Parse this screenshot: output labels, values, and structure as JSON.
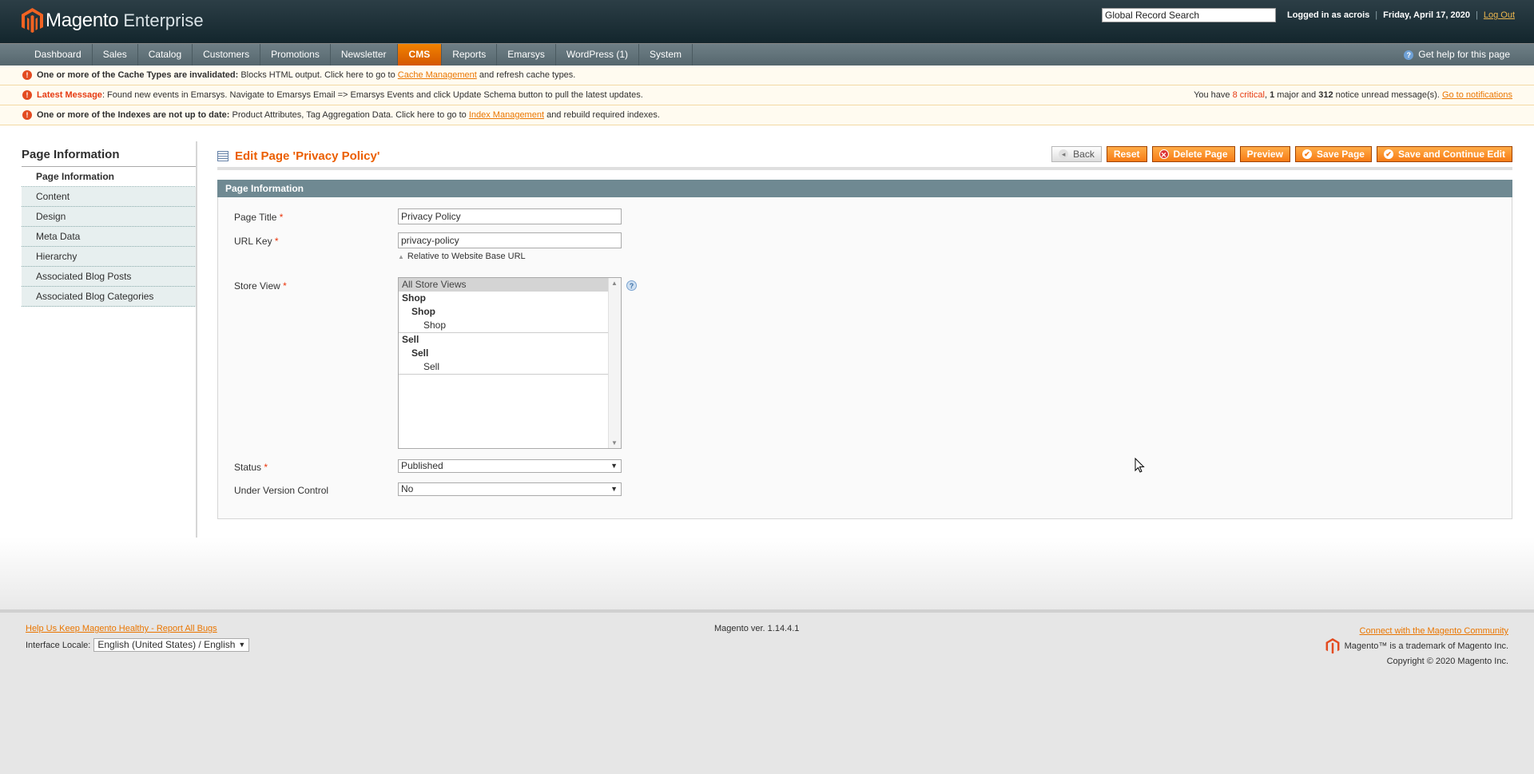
{
  "header": {
    "brand": "Magento",
    "brand_sub": "Enterprise",
    "search_value": "Global Record Search",
    "logged_in_text": "Logged in as acrois",
    "date": "Friday, April 17, 2020",
    "logout": "Log Out",
    "separator": "|"
  },
  "nav": {
    "items": [
      "Dashboard",
      "Sales",
      "Catalog",
      "Customers",
      "Promotions",
      "Newsletter",
      "CMS",
      "Reports",
      "Emarsys",
      "WordPress (1)",
      "System"
    ],
    "active": "CMS",
    "help": "Get help for this page"
  },
  "messages": {
    "cache_bold": "One or more of the Cache Types are invalidated:",
    "cache_text1": " Blocks HTML output. Click here to go to ",
    "cache_link": "Cache Management",
    "cache_text2": " and refresh cache types.",
    "latest_label": "Latest Message",
    "latest_text": ": Found new events in Emarsys. Navigate to Emarsys Email => Emarsys Events and click Update Schema button to pull the latest updates.",
    "unread_pre": "You have ",
    "critical": "8 critical",
    "comma": ", ",
    "major_count": "1",
    "major_text": " major and ",
    "notice_count": "312",
    "notice_text": " notice unread message(s). ",
    "notifications_link": "Go to notifications",
    "index_bold": "One or more of the Indexes are not up to date:",
    "index_text1": " Product Attributes, Tag Aggregation Data. Click here to go to ",
    "index_link": "Index Management",
    "index_text2": " and rebuild required indexes."
  },
  "sidebar": {
    "title": "Page Information",
    "items": [
      "Page Information",
      "Content",
      "Design",
      "Meta Data",
      "Hierarchy",
      "Associated Blog Posts",
      "Associated Blog Categories"
    ]
  },
  "page": {
    "title": "Edit Page 'Privacy Policy'",
    "buttons": {
      "back": "Back",
      "reset": "Reset",
      "delete": "Delete Page",
      "preview": "Preview",
      "save": "Save Page",
      "save_continue": "Save and Continue Edit"
    }
  },
  "form": {
    "section_title": "Page Information",
    "required_mark": "*",
    "page_title_label": "Page Title",
    "page_title_value": "Privacy Policy",
    "url_key_label": "URL Key",
    "url_key_value": "privacy-policy",
    "url_note": "Relative to Website Base URL",
    "store_view_label": "Store View",
    "store_options": {
      "all": "All Store Views",
      "shop_website": "Shop",
      "shop_group": "Shop",
      "shop_view": "Shop",
      "sell_website": "Sell",
      "sell_group": "Sell",
      "sell_view": "Sell"
    },
    "status_label": "Status",
    "status_value": "Published",
    "version_label": "Under Version Control",
    "version_value": "No"
  },
  "footer": {
    "bugs_link": "Help Us Keep Magento Healthy - Report All Bugs",
    "locale_label": "Interface Locale:",
    "locale_value": "English (United States) / English",
    "version": "Magento ver. 1.14.4.1",
    "community_link": "Connect with the Magento Community",
    "trademark": "Magento™ is a trademark of Magento Inc.",
    "copyright": "Copyright © 2020 Magento Inc."
  },
  "colors": {
    "accent": "#eb5e00",
    "button": "#f77c16",
    "header_bg": "#1c3038",
    "section_bar": "#6f8992"
  }
}
